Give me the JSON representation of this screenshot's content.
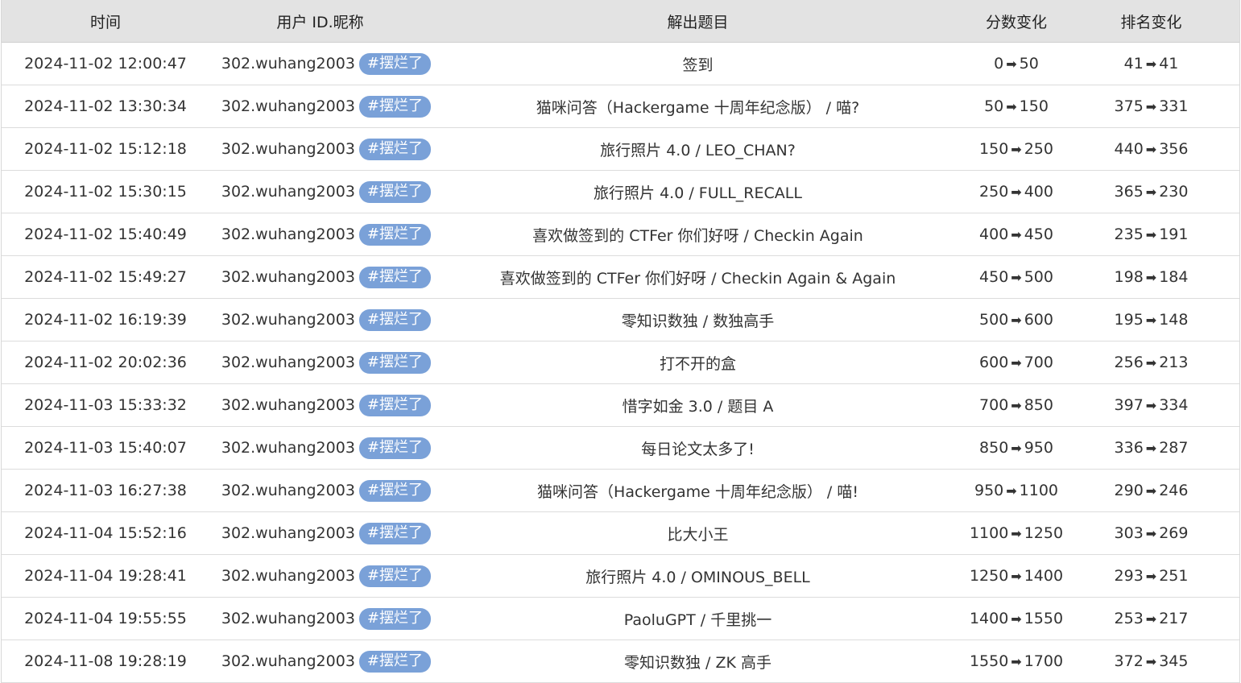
{
  "headers": [
    "时间",
    "用户 ID.昵称",
    "解出题目",
    "分数变化",
    "排名变化"
  ],
  "arrow": "➡",
  "rows": [
    {
      "time": "2024-11-02 12:00:47",
      "user": "302.wuhang2003",
      "tag": "#摆烂了",
      "problem": "签到",
      "score_from": "0",
      "score_to": "50",
      "rank_from": "41",
      "rank_to": "41"
    },
    {
      "time": "2024-11-02 13:30:34",
      "user": "302.wuhang2003",
      "tag": "#摆烂了",
      "problem": "猫咪问答（Hackergame 十周年纪念版） / 喵?",
      "score_from": "50",
      "score_to": "150",
      "rank_from": "375",
      "rank_to": "331"
    },
    {
      "time": "2024-11-02 15:12:18",
      "user": "302.wuhang2003",
      "tag": "#摆烂了",
      "problem": "旅行照片 4.0 / LEO_CHAN?",
      "score_from": "150",
      "score_to": "250",
      "rank_from": "440",
      "rank_to": "356"
    },
    {
      "time": "2024-11-02 15:30:15",
      "user": "302.wuhang2003",
      "tag": "#摆烂了",
      "problem": "旅行照片 4.0 / FULL_RECALL",
      "score_from": "250",
      "score_to": "400",
      "rank_from": "365",
      "rank_to": "230"
    },
    {
      "time": "2024-11-02 15:40:49",
      "user": "302.wuhang2003",
      "tag": "#摆烂了",
      "problem": "喜欢做签到的 CTFer 你们好呀 / Checkin Again",
      "score_from": "400",
      "score_to": "450",
      "rank_from": "235",
      "rank_to": "191"
    },
    {
      "time": "2024-11-02 15:49:27",
      "user": "302.wuhang2003",
      "tag": "#摆烂了",
      "problem": "喜欢做签到的 CTFer 你们好呀 / Checkin Again & Again",
      "score_from": "450",
      "score_to": "500",
      "rank_from": "198",
      "rank_to": "184"
    },
    {
      "time": "2024-11-02 16:19:39",
      "user": "302.wuhang2003",
      "tag": "#摆烂了",
      "problem": "零知识数独 / 数独高手",
      "score_from": "500",
      "score_to": "600",
      "rank_from": "195",
      "rank_to": "148"
    },
    {
      "time": "2024-11-02 20:02:36",
      "user": "302.wuhang2003",
      "tag": "#摆烂了",
      "problem": "打不开的盒",
      "score_from": "600",
      "score_to": "700",
      "rank_from": "256",
      "rank_to": "213"
    },
    {
      "time": "2024-11-03 15:33:32",
      "user": "302.wuhang2003",
      "tag": "#摆烂了",
      "problem": "惜字如金 3.0 / 题目 A",
      "score_from": "700",
      "score_to": "850",
      "rank_from": "397",
      "rank_to": "334"
    },
    {
      "time": "2024-11-03 15:40:07",
      "user": "302.wuhang2003",
      "tag": "#摆烂了",
      "problem": "每日论文太多了!",
      "score_from": "850",
      "score_to": "950",
      "rank_from": "336",
      "rank_to": "287"
    },
    {
      "time": "2024-11-03 16:27:38",
      "user": "302.wuhang2003",
      "tag": "#摆烂了",
      "problem": "猫咪问答（Hackergame 十周年纪念版） / 喵!",
      "score_from": "950",
      "score_to": "1100",
      "rank_from": "290",
      "rank_to": "246"
    },
    {
      "time": "2024-11-04 15:52:16",
      "user": "302.wuhang2003",
      "tag": "#摆烂了",
      "problem": "比大小王",
      "score_from": "1100",
      "score_to": "1250",
      "rank_from": "303",
      "rank_to": "269"
    },
    {
      "time": "2024-11-04 19:28:41",
      "user": "302.wuhang2003",
      "tag": "#摆烂了",
      "problem": "旅行照片 4.0 / OMINOUS_BELL",
      "score_from": "1250",
      "score_to": "1400",
      "rank_from": "293",
      "rank_to": "251"
    },
    {
      "time": "2024-11-04 19:55:55",
      "user": "302.wuhang2003",
      "tag": "#摆烂了",
      "problem": "PaoluGPT / 千里挑一",
      "score_from": "1400",
      "score_to": "1550",
      "rank_from": "253",
      "rank_to": "217"
    },
    {
      "time": "2024-11-08 19:28:19",
      "user": "302.wuhang2003",
      "tag": "#摆烂了",
      "problem": "零知识数独 / ZK 高手",
      "score_from": "1550",
      "score_to": "1700",
      "rank_from": "372",
      "rank_to": "345"
    }
  ]
}
